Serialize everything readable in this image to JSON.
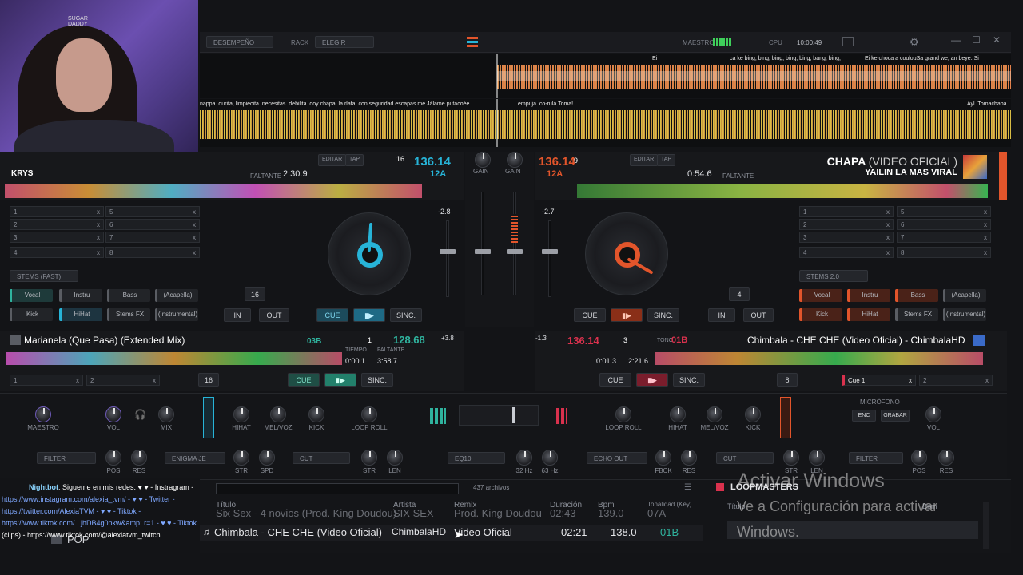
{
  "topbar": {
    "layout_dropdown": "DESEMPEÑO",
    "rack_label": "RACK",
    "rack_dropdown": "ELEGIR",
    "master_label": "MAESTRO",
    "cpu_label": "CPU",
    "clock": "10:00:49"
  },
  "lyrics": {
    "top_1": "Ei",
    "top_2": "ca ke bing, bing, bing, bing, bing, bang, bing,",
    "top_3": "Ei ke choca a coulouSa grand we, an beye. Si",
    "bottom_1": "nappa. durita, limpiecita. necesitas. debilita. doy chapa. la rlafa, con seguridad escapas me Jálame putacoée",
    "bottom_2": "empuja. co-rulá Toma!",
    "bottom_3": "Ayl. Tomachapa."
  },
  "deck1": {
    "partial_title": "KRYS",
    "edit_label": "EDITAR",
    "tap_label": "TAP",
    "beat_counter": "16",
    "bpm": "136.14",
    "key": "12A",
    "remaining_label": "FALTANTE",
    "remaining": "2:30.9",
    "pitch": "-2.8",
    "stem_preset": "STEMS (FAST)",
    "stems_row1": [
      "Vocal",
      "Instru",
      "Bass",
      "(Acapella)"
    ],
    "stems_row2": [
      "Kick",
      "HiHat",
      "Stems FX",
      "(Instrumental)"
    ],
    "hotcues": [
      "1",
      "2",
      "3",
      "4",
      "5",
      "6",
      "7",
      "8"
    ],
    "loop_size": "16",
    "in_label": "IN",
    "out_label": "OUT",
    "cue_label": "CUE",
    "sync_label": "SINC."
  },
  "deck2": {
    "title": "CHAPA",
    "title_suffix": "(VIDEO OFICIAL)",
    "artist": "YAILIN LA MAS VIRAL",
    "bpm": "136.14",
    "beat_counter": "9",
    "key": "12A",
    "edit_label": "EDITAR",
    "tap_label": "TAP",
    "remaining_label": "FALTANTE",
    "remaining": "0:54.6",
    "pitch": "-2.7",
    "stem_preset": "STEMS 2.0",
    "stems_row1": [
      "Vocal",
      "Instru",
      "Bass",
      "(Acapella)"
    ],
    "stems_row2": [
      "Kick",
      "HiHat",
      "Stems FX",
      "(Instrumental)"
    ],
    "hotcues": [
      "1",
      "2",
      "3",
      "4",
      "5",
      "6",
      "7",
      "8"
    ],
    "loop_size": "4",
    "in_label": "IN",
    "out_label": "OUT",
    "cue_label": "CUE",
    "sync_label": "SINC."
  },
  "deck3": {
    "title": "Marianela (Que Pasa) (Extended Mix)",
    "key": "03B",
    "beat_counter": "1",
    "bpm": "128.68",
    "pitch": "+3.8",
    "time_label": "TIEMPO",
    "elapsed": "0:00.1",
    "remaining_label": "FALTANTE",
    "remaining": "3:58.7",
    "loop_size": "16",
    "cue_label": "CUE",
    "sync_label": "SINC.",
    "hotcues": [
      "1",
      "2"
    ]
  },
  "deck4": {
    "title": "Chimbala - CHE CHE (Video Oficial) - ChimbalaHD",
    "bpm": "136.14",
    "beat_counter": "3",
    "tone_label": "TONO",
    "key": "01B",
    "pitch": "-1.3",
    "elapsed": "0:01.3",
    "remaining": "2:21.6",
    "loop_size": "8",
    "cue_label": "CUE",
    "sync_label": "SINC.",
    "hotcues": [
      "Cue 1",
      "2"
    ]
  },
  "mixer": {
    "gain_label": "GAIN",
    "knobs_left": [
      "MAESTRO",
      "VOL",
      "MIX",
      "HIHAT",
      "MEL/VOZ",
      "KICK",
      "LOOP ROLL"
    ],
    "knobs_right": [
      "LOOP ROLL",
      "HIHAT",
      "MEL/VOZ",
      "KICK"
    ],
    "mic_label": "MICRÓFONO",
    "mic_enc": "ENC",
    "mic_rec": "GRABAR",
    "mic_vol": "VOL",
    "fx_left": [
      "FILTER",
      "ENIGMA JE",
      "CUT"
    ],
    "fx_mid": [
      "EQ10",
      "ECHO OUT",
      "CUT",
      "FILTER"
    ],
    "fx_labels": [
      "POS",
      "RES",
      "STR",
      "SPD",
      "STR",
      "LEN",
      "32 Hz",
      "63 Hz",
      "FBCK",
      "RES",
      "STR",
      "LEN",
      "POS",
      "RES"
    ]
  },
  "library": {
    "count": "437 archivos",
    "headers": [
      "Título",
      "Artista",
      "Remix",
      "Duración",
      "Bpm",
      "Tonalidad (Key)"
    ],
    "prev_row": [
      "Six Sex - 4 novios (Prod. King Doudou)",
      "SIX SEX",
      "Prod. King Doudou",
      "02:43",
      "139.0",
      "07A"
    ],
    "row": [
      "Chimbala - CHE CHE (Video Oficial)",
      "ChimbalaHD",
      "Video Oficial",
      "02:21",
      "138.0",
      "01B"
    ],
    "loopmasters_label": "LOOPMASTERS",
    "side_header_1": "Título",
    "side_header_2": "Bpm",
    "sidebar_item": "POP"
  },
  "chat": {
    "bot_name": "Nightbot",
    "bot_message": ": Sigueme en mis redes. ♥ ♥ - Instragram -",
    "line1": "https://www.instagram.com/alexia_tvm/ - ♥ ♥ - Twitter -",
    "line2": "https://twitter.com/AlexiaTVM - ♥ ♥ - Tiktok -",
    "line3": "https://www.tiktok.com/...jhDB4g0pkw&amp; r=1 - ♥ ♥ - Tiktok",
    "line4": "(clips) - https://www.tiktok.com/@alexiatvm_twitch"
  },
  "watermark": {
    "title": "Activar Windows",
    "line1": "Ve a Configuración para activar",
    "line2": "Windows."
  },
  "colors": {
    "deck1_accent": "#27b4d8",
    "deck2_accent": "#e2552b",
    "deck3_accent": "#2fb39e",
    "deck4_accent": "#d9314d",
    "waveform_mix": "#e8a23a"
  }
}
